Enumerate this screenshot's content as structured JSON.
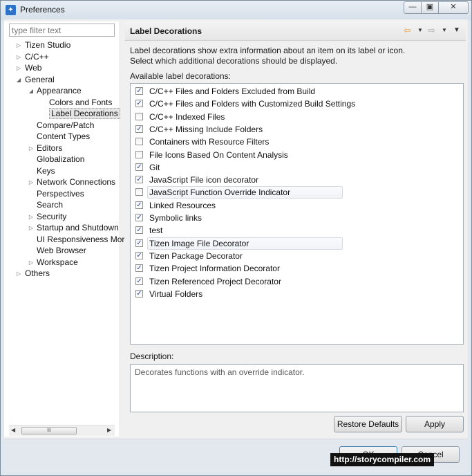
{
  "window": {
    "title": "Preferences"
  },
  "window_controls": {
    "minimize": "—",
    "maximize": "▣",
    "close": "✕"
  },
  "filter": {
    "placeholder": "type filter text"
  },
  "tree": [
    {
      "label": "Tizen Studio",
      "level": 0,
      "expander": "collapsed"
    },
    {
      "label": "C/C++",
      "level": 0,
      "expander": "collapsed"
    },
    {
      "label": "Web",
      "level": 0,
      "expander": "collapsed"
    },
    {
      "label": "General",
      "level": 0,
      "expander": "expanded"
    },
    {
      "label": "Appearance",
      "level": 1,
      "expander": "expanded"
    },
    {
      "label": "Colors and Fonts",
      "level": 2,
      "expander": "none"
    },
    {
      "label": "Label Decorations",
      "level": 2,
      "expander": "none",
      "selected": true
    },
    {
      "label": "Compare/Patch",
      "level": 1,
      "expander": "none"
    },
    {
      "label": "Content Types",
      "level": 1,
      "expander": "none"
    },
    {
      "label": "Editors",
      "level": 1,
      "expander": "collapsed"
    },
    {
      "label": "Globalization",
      "level": 1,
      "expander": "none"
    },
    {
      "label": "Keys",
      "level": 1,
      "expander": "none"
    },
    {
      "label": "Network Connections",
      "level": 1,
      "expander": "collapsed"
    },
    {
      "label": "Perspectives",
      "level": 1,
      "expander": "none"
    },
    {
      "label": "Search",
      "level": 1,
      "expander": "none"
    },
    {
      "label": "Security",
      "level": 1,
      "expander": "collapsed"
    },
    {
      "label": "Startup and Shutdown",
      "level": 1,
      "expander": "collapsed"
    },
    {
      "label": "UI Responsiveness Mor",
      "level": 1,
      "expander": "none"
    },
    {
      "label": "Web Browser",
      "level": 1,
      "expander": "none"
    },
    {
      "label": "Workspace",
      "level": 1,
      "expander": "collapsed"
    },
    {
      "label": "Others",
      "level": 0,
      "expander": "collapsed"
    }
  ],
  "scrollbar": {
    "left_arrow": "◀",
    "right_arrow": "▶",
    "grip": "III"
  },
  "page": {
    "title": "Label Decorations",
    "description_line1": "Label decorations show extra information about an item on its label or icon.",
    "description_line2": "Select which additional decorations should be displayed.",
    "available_label": "Available label decorations:"
  },
  "nav": {
    "back_icon": "⇦",
    "forward_icon": "⇨",
    "dropdown": "▼"
  },
  "decorations": [
    {
      "label": "C/C++ Files and Folders Excluded from Build",
      "checked": true
    },
    {
      "label": "C/C++ Files and Folders with Customized Build Settings",
      "checked": true
    },
    {
      "label": "C/C++ Indexed Files",
      "checked": false
    },
    {
      "label": "C/C++ Missing Include Folders",
      "checked": true
    },
    {
      "label": "Containers with Resource Filters",
      "checked": false
    },
    {
      "label": "File Icons Based On Content Analysis",
      "checked": false
    },
    {
      "label": "Git",
      "checked": true
    },
    {
      "label": "JavaScript File icon decorator",
      "checked": true
    },
    {
      "label": "JavaScript Function Override Indicator",
      "checked": false,
      "highlight": true
    },
    {
      "label": "Linked Resources",
      "checked": true
    },
    {
      "label": "Symbolic links",
      "checked": true
    },
    {
      "label": "test",
      "checked": true
    },
    {
      "label": "Tizen Image File Decorator",
      "checked": true,
      "highlight": true
    },
    {
      "label": "Tizen Package Decorator",
      "checked": true
    },
    {
      "label": "Tizen Project Information Decorator",
      "checked": true
    },
    {
      "label": "Tizen Referenced Project Decorator",
      "checked": true
    },
    {
      "label": "Virtual Folders",
      "checked": true
    }
  ],
  "description": {
    "heading": "Description:",
    "text": "Decorates functions with an override indicator."
  },
  "buttons": {
    "restore_defaults": "Restore Defaults",
    "apply": "Apply",
    "ok": "OK",
    "cancel": "Cancel"
  },
  "watermark": "http://storycompiler.com",
  "colors": {
    "checkmark": "#26489b",
    "back_arrow": "#e8a23a"
  }
}
